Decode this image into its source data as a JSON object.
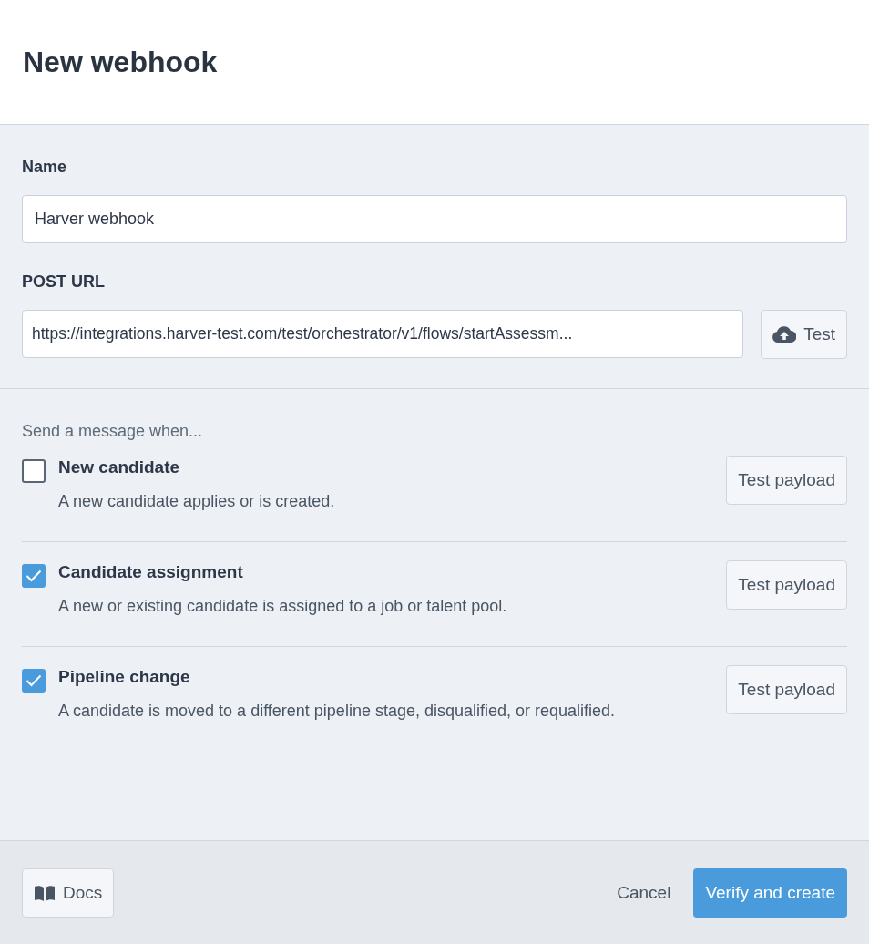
{
  "title": "New webhook",
  "name_field": {
    "label": "Name",
    "value": "Harver webhook"
  },
  "url_field": {
    "label": "POST URL",
    "value": "https://integrations.harver-test.com/test/orchestrator/v1/flows/startAssessm...",
    "test_button": "Test"
  },
  "events_heading": "Send a message when...",
  "events": [
    {
      "title": "New candidate",
      "description": "A new candidate applies or is created.",
      "checked": false,
      "button": "Test payload"
    },
    {
      "title": "Candidate assignment",
      "description": "A new or existing candidate is assigned to a job or talent pool.",
      "checked": true,
      "button": "Test payload"
    },
    {
      "title": "Pipeline change",
      "description": "A candidate is moved to a different pipeline stage, disqualified, or requalified.",
      "checked": true,
      "button": "Test payload"
    }
  ],
  "footer": {
    "docs": "Docs",
    "cancel": "Cancel",
    "submit": "Verify and create"
  }
}
